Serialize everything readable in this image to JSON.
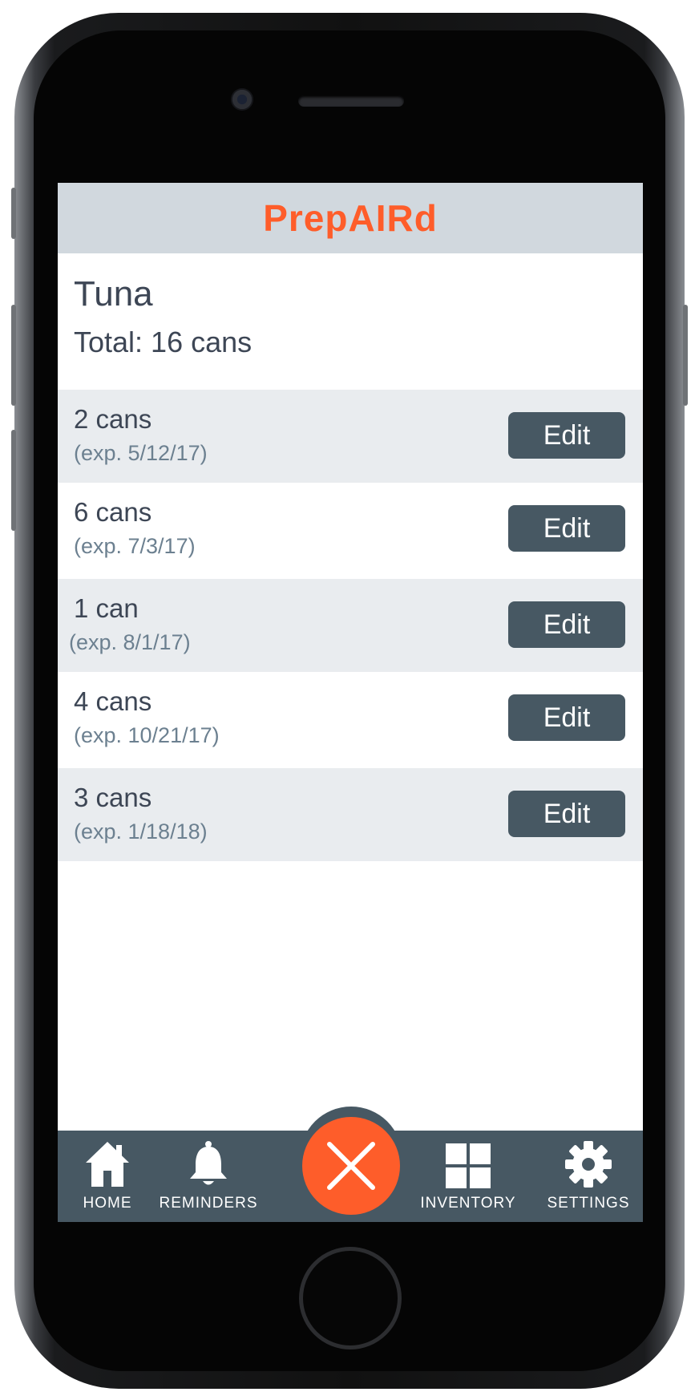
{
  "app": {
    "title": "PrepAIRd"
  },
  "item": {
    "name": "Tuna",
    "total": "Total: 16 cans"
  },
  "batches": [
    {
      "qty": "2 cans",
      "exp": "(exp. 5/12/17)",
      "edit_label": "Edit"
    },
    {
      "qty": "6 cans",
      "exp": "(exp. 7/3/17)",
      "edit_label": "Edit"
    },
    {
      "qty": "1 can",
      "exp": "(exp. 8/1/17)",
      "edit_label": "Edit"
    },
    {
      "qty": "4 cans",
      "exp": "(exp. 10/21/17)",
      "edit_label": "Edit"
    },
    {
      "qty": "3 cans",
      "exp": "(exp. 1/18/18)",
      "edit_label": "Edit"
    }
  ],
  "nav": {
    "items": [
      {
        "label": "HOME",
        "icon": "home-icon"
      },
      {
        "label": "REMINDERS",
        "icon": "bell-icon"
      },
      {
        "label": "INVENTORY",
        "icon": "grid-icon"
      },
      {
        "label": "SETTINGS",
        "icon": "gear-icon"
      }
    ],
    "center_icon": "close-icon"
  },
  "colors": {
    "accent": "#fe5d2a",
    "header_bg": "#d1d8de",
    "nav_bg": "#475863",
    "row_alt_bg": "#e9ecef",
    "text_dark": "#3d4655",
    "text_muted": "#6c8090"
  }
}
